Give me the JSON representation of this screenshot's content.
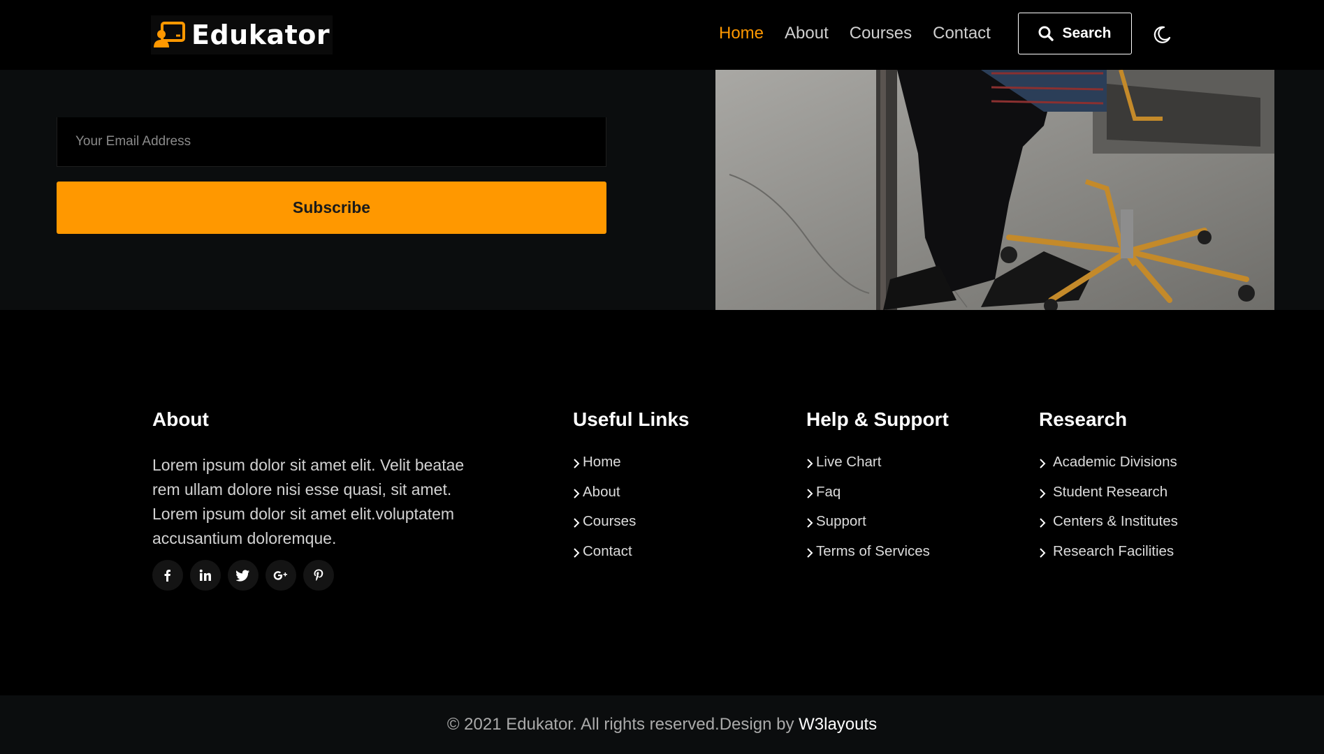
{
  "header": {
    "logo_text": "Edukator",
    "nav": [
      "Home",
      "About",
      "Courses",
      "Contact"
    ],
    "active_nav": "Home",
    "search_label": "Search",
    "accent_color": "#ff9800"
  },
  "newsletter": {
    "email_placeholder": "Your Email Address",
    "email_value": "",
    "subscribe_label": "Subscribe"
  },
  "footer": {
    "about": {
      "title": "About",
      "text": "Lorem ipsum dolor sit amet elit. Velit beatae rem ullam dolore nisi esse quasi, sit amet. Lorem ipsum dolor sit amet elit.voluptatem accusantium doloremque.",
      "socials": [
        "facebook-icon",
        "linkedin-icon",
        "twitter-icon",
        "google-plus-icon",
        "pinterest-icon"
      ]
    },
    "useful_links": {
      "title": "Useful Links",
      "items": [
        "Home",
        "About",
        "Courses",
        "Contact"
      ]
    },
    "help_support": {
      "title": "Help & Support",
      "items": [
        "Live Chart",
        "Faq",
        "Support",
        "Terms of Services"
      ]
    },
    "research": {
      "title": "Research",
      "items": [
        "Academic Divisions",
        "Student Research",
        "Centers & Institutes",
        "Research Facilities"
      ]
    }
  },
  "copyright": {
    "text": "© 2021 Edukator. All rights reserved.Design by ",
    "link": "W3layouts"
  }
}
